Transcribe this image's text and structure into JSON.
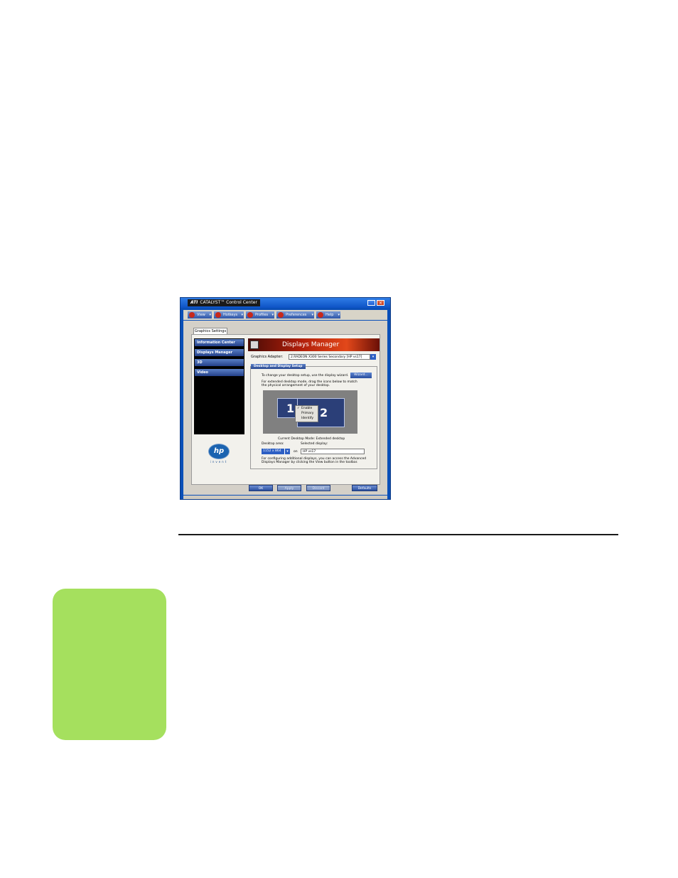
{
  "window": {
    "title_brand": "ATI",
    "title": "CATALYST™ Control Center",
    "minimize": "_",
    "close": "×",
    "menus": [
      {
        "label": "View"
      },
      {
        "label": "Hotkeys"
      },
      {
        "label": "Profiles"
      },
      {
        "label": "Preferences"
      },
      {
        "label": "Help"
      }
    ],
    "tab": "Graphics Settings",
    "nav": [
      {
        "label": "Information Center"
      },
      {
        "label": "Displays Manager"
      },
      {
        "label": "3D"
      },
      {
        "label": "Video"
      }
    ],
    "logo": {
      "mark": "hp",
      "tagline": "invent"
    },
    "banner_title": "Displays Manager",
    "graphics_adapter": {
      "label": "Graphics Adapter:",
      "value": "2.RADEON X300 Series Secondary [HP vs17]"
    },
    "group": {
      "title": "Desktop and Display Setup",
      "wizard_text": "To change your desktop setup, use the display wizard.",
      "wizard_button": "Wizard...",
      "instructions_1": "For extended desktop mode, drag the icons below to match",
      "instructions_2": "the physical arrangement of your desktop.",
      "monitor_1": "1",
      "monitor_2": "2",
      "context_menu": [
        "Enable",
        "Primary",
        "Identify"
      ],
      "current_mode": "Current Desktop Mode: Extended desktop",
      "desktop_area_label": "Desktop area:",
      "selected_display_label": "Selected display:",
      "desktop_area_value": "1152 x 864",
      "on_label": "on",
      "selected_display_value": "HP vs17",
      "footer_1": "For configuring additional displays, you can access the Advanced",
      "footer_2": "Displays Manager by clicking the View button in the toolbar."
    },
    "buttons": {
      "ok": "OK",
      "apply": "Apply",
      "discard": "Discard",
      "defaults": "Defaults"
    }
  },
  "colors": {
    "side_tab": "#a5e05e",
    "window_frame": "#0a4fb8"
  }
}
